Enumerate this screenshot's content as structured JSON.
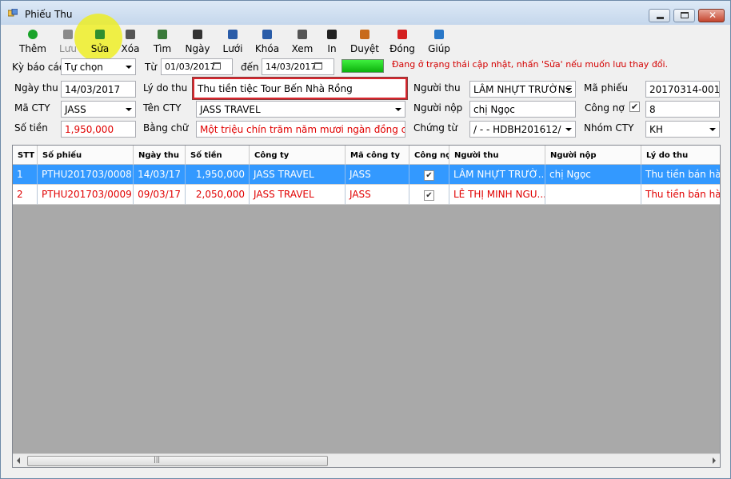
{
  "window": {
    "title": "Phiếu Thu"
  },
  "toolbar": [
    {
      "label": "Thêm",
      "icon": "add-icon",
      "color": "#1aa32a"
    },
    {
      "label": "Lưu",
      "icon": "save-icon",
      "color": "#8a8a8a"
    },
    {
      "label": "Sửa",
      "icon": "edit-pencil-icon",
      "color": "#2f8f2f"
    },
    {
      "label": "Xóa",
      "icon": "delete-icon",
      "color": "#555555"
    },
    {
      "label": "Tìm",
      "icon": "find-icon",
      "color": "#3a7a3a"
    },
    {
      "label": "Ngày",
      "icon": "calendar-day-icon",
      "color": "#333333"
    },
    {
      "label": "Lưới",
      "icon": "grid-icon",
      "color": "#2a5ca8"
    },
    {
      "label": "Khóa",
      "icon": "lock-icon",
      "color": "#2a5ca8"
    },
    {
      "label": "Xem",
      "icon": "preview-icon",
      "color": "#555555"
    },
    {
      "label": "In",
      "icon": "print-icon",
      "color": "#222222"
    },
    {
      "label": "Duyệt",
      "icon": "approve-icon",
      "color": "#c86a1a"
    },
    {
      "label": "Đóng",
      "icon": "power-icon",
      "color": "#d42020"
    },
    {
      "label": "Giúp",
      "icon": "help-book-icon",
      "color": "#2a78c8"
    }
  ],
  "filter": {
    "ky_bao_cao_label": "Kỳ báo cáo",
    "ky_bao_cao_value": "Tự chọn",
    "tu_label": "Từ",
    "tu_value": "01/03/2017",
    "den_label": "đến",
    "den_value": "14/03/2017",
    "status_message": "Đang ở trạng thái cập nhật, nhấn 'Sửa' nếu muốn lưu thay đổi."
  },
  "form": {
    "ngay_thu_label": "Ngày thu",
    "ngay_thu_value": "14/03/2017",
    "ly_do_thu_label": "Lý do thu",
    "ly_do_thu_value": "Thu tiền tiệc Tour Bến Nhà Rồng",
    "nguoi_thu_label": "Người thu",
    "nguoi_thu_value": "LÂM NHỰT TRƯỜNG",
    "ma_phieu_label": "Mã phiếu",
    "ma_phieu_value": "20170314-001",
    "ma_cty_label": "Mã CTY",
    "ma_cty_value": "JASS",
    "ten_cty_label": "Tên CTY",
    "ten_cty_value": "JASS TRAVEL",
    "nguoi_nop_label": "Người nộp",
    "nguoi_nop_value": "chị Ngọc",
    "cong_no_label": "Công nợ",
    "cong_no_checked": true,
    "cong_no_value": "8",
    "so_tien_label": "Số tiền",
    "so_tien_value": "1,950,000",
    "bang_chu_label": "Bằng chữ",
    "bang_chu_value": "Một triệu chín trăm năm mươi ngàn đồng chẵn",
    "chung_tu_label": "Chứng từ",
    "chung_tu_value": "/ - -  HDBH201612/",
    "nhom_cty_label": "Nhóm CTY",
    "nhom_cty_value": "KH"
  },
  "table": {
    "headers": [
      "STT",
      "Số phiếu",
      "Ngày thu",
      "Số tiền",
      "Công ty",
      "Mã công ty",
      "Công nợ",
      "Người thu",
      "Người nộp",
      "Lý do thu"
    ],
    "rows": [
      {
        "stt": "1",
        "so_phieu": "PTHU201703/0008",
        "ngay_thu": "14/03/17",
        "so_tien": "1,950,000",
        "cong_ty": "JASS TRAVEL",
        "ma_cong_ty": "JASS",
        "cong_no": true,
        "nguoi_thu": "LÂM NHỰT TRƯỜ...",
        "nguoi_nop": "chị Ngọc",
        "ly_do_thu": "Thu tiền bán hàng"
      },
      {
        "stt": "2",
        "so_phieu": "PTHU201703/0009",
        "ngay_thu": "09/03/17",
        "so_tien": "2,050,000",
        "cong_ty": "JASS TRAVEL",
        "ma_cong_ty": "JASS",
        "cong_no": true,
        "nguoi_thu": "LÊ THỊ MINH NGU...",
        "nguoi_nop": "",
        "ly_do_thu": "Thu tiền bán hàng"
      }
    ]
  },
  "colors": {
    "selected_row": "#3399ff",
    "red_text": "#e00000",
    "highlight": "#eeee1e",
    "status_green": "#1ec81e"
  }
}
